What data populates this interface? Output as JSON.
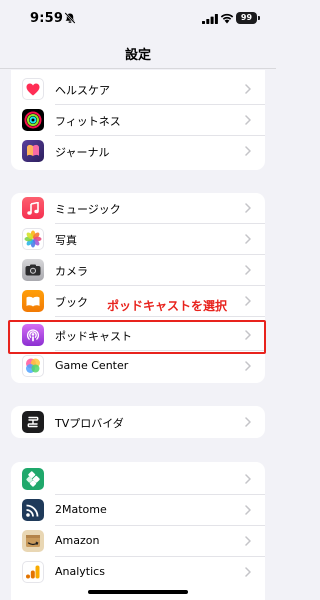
{
  "status_bar": {
    "time": "9:59",
    "battery": "99"
  },
  "nav": {
    "title": "設定"
  },
  "groups": [
    {
      "items": [
        {
          "label": "ヘルスケア",
          "icon": "health-icon"
        },
        {
          "label": "フィットネス",
          "icon": "fitness-icon"
        },
        {
          "label": "ジャーナル",
          "icon": "journal-icon"
        }
      ]
    },
    {
      "items": [
        {
          "label": "ミュージック",
          "icon": "music-icon"
        },
        {
          "label": "写真",
          "icon": "photos-icon"
        },
        {
          "label": "カメラ",
          "icon": "camera-icon"
        },
        {
          "label": "ブック",
          "icon": "books-icon"
        },
        {
          "label": "ポッドキャスト",
          "icon": "podcasts-icon"
        },
        {
          "label": "Game Center",
          "icon": "game-center-icon"
        }
      ]
    },
    {
      "items": [
        {
          "label": "TVプロバイダ",
          "icon": "tv-provider-icon"
        }
      ]
    },
    {
      "items": [
        {
          "label": "",
          "icon": "green-app-icon"
        },
        {
          "label": "2Matome",
          "icon": "2matome-icon"
        },
        {
          "label": "Amazon",
          "icon": "amazon-icon"
        },
        {
          "label": "Analytics",
          "icon": "analytics-icon"
        }
      ]
    }
  ],
  "annotation": {
    "text": "ポッドキャストを選択"
  },
  "colors": {
    "highlight": "#e8231d",
    "background": "#f2f2f7"
  }
}
